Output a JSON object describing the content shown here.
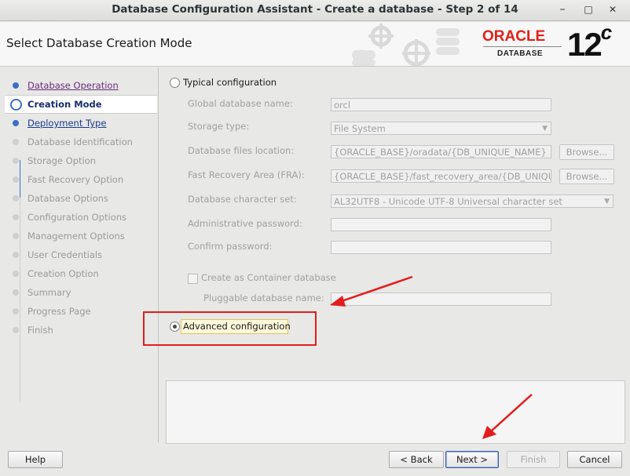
{
  "window": {
    "title": "Database Configuration Assistant - Create a database - Step 2 of 14",
    "minimize_glyph": "–",
    "maximize_glyph": "□",
    "close_glyph": "✕"
  },
  "header": {
    "title": "Select Database Creation Mode",
    "brand": "ORACLE",
    "brand_sub": "DATABASE",
    "version": "12",
    "version_suffix": "c"
  },
  "nav": {
    "items": [
      {
        "label": "Database Operation",
        "state": "visited"
      },
      {
        "label": "Creation Mode",
        "state": "current"
      },
      {
        "label": "Deployment Type",
        "state": "link"
      },
      {
        "label": "Database Identification",
        "state": "disabled"
      },
      {
        "label": "Storage Option",
        "state": "disabled"
      },
      {
        "label": "Fast Recovery Option",
        "state": "disabled"
      },
      {
        "label": "Database Options",
        "state": "disabled"
      },
      {
        "label": "Configuration Options",
        "state": "disabled"
      },
      {
        "label": "Management Options",
        "state": "disabled"
      },
      {
        "label": "User Credentials",
        "state": "disabled"
      },
      {
        "label": "Creation Option",
        "state": "disabled"
      },
      {
        "label": "Summary",
        "state": "disabled"
      },
      {
        "label": "Progress Page",
        "state": "disabled"
      },
      {
        "label": "Finish",
        "state": "disabled"
      }
    ]
  },
  "form": {
    "typical_label": "Typical configuration",
    "global_db_name_label": "Global database name:",
    "global_db_name_value": "orcl",
    "storage_type_label": "Storage type:",
    "storage_type_value": "File System",
    "db_files_location_label": "Database files location:",
    "db_files_location_value": "{ORACLE_BASE}/oradata/{DB_UNIQUE_NAME}",
    "fra_label": "Fast Recovery Area (FRA):",
    "fra_value": "{ORACLE_BASE}/fast_recovery_area/{DB_UNIQU",
    "browse_label": "Browse...",
    "charset_label": "Database character set:",
    "charset_value": "AL32UTF8 - Unicode UTF-8 Universal character set",
    "admin_password_label": "Administrative password:",
    "confirm_password_label": "Confirm password:",
    "container_label": "Create as Container database",
    "pluggable_label": "Pluggable database name:",
    "advanced_label": "Advanced configuration",
    "selected": "advanced"
  },
  "buttons": {
    "help": "Help",
    "back": "< Back",
    "next": "Next >",
    "finish": "Finish",
    "cancel": "Cancel"
  },
  "colors": {
    "annotation_red": "#e31c1c",
    "oracle_red": "#e0201b",
    "nav_active": "#3b6fc4"
  }
}
